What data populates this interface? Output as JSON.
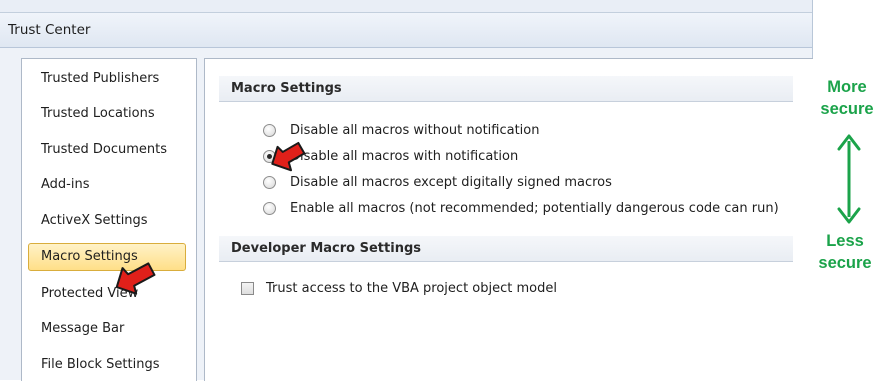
{
  "window": {
    "title": "Trust Center"
  },
  "sidebar": {
    "items": [
      {
        "label": "Trusted Publishers",
        "selected": false
      },
      {
        "label": "Trusted Locations",
        "selected": false
      },
      {
        "label": "Trusted Documents",
        "selected": false
      },
      {
        "label": "Add-ins",
        "selected": false
      },
      {
        "label": "ActiveX Settings",
        "selected": false
      },
      {
        "label": "Macro Settings",
        "selected": true
      },
      {
        "label": "Protected View",
        "selected": false
      },
      {
        "label": "Message Bar",
        "selected": false
      },
      {
        "label": "File Block Settings",
        "selected": false
      }
    ]
  },
  "macro_settings": {
    "header": "Macro Settings",
    "options": [
      {
        "label": "Disable all macros without notification",
        "checked": false
      },
      {
        "label": "Disable all macros with notification",
        "checked": true
      },
      {
        "label": "Disable all macros except digitally signed macros",
        "checked": false
      },
      {
        "label": "Enable all macros (not recommended; potentially dangerous code can run)",
        "checked": false
      }
    ]
  },
  "developer_settings": {
    "header": "Developer Macro Settings",
    "trust_vba_label": "Trust access to the VBA project object model",
    "trust_vba_checked": false
  },
  "annotations": {
    "more_line1": "More",
    "more_line2": "secure",
    "less_line1": "Less",
    "less_line2": "secure",
    "text_color": "#1ba34a",
    "pointer_color": "#e0201a"
  }
}
